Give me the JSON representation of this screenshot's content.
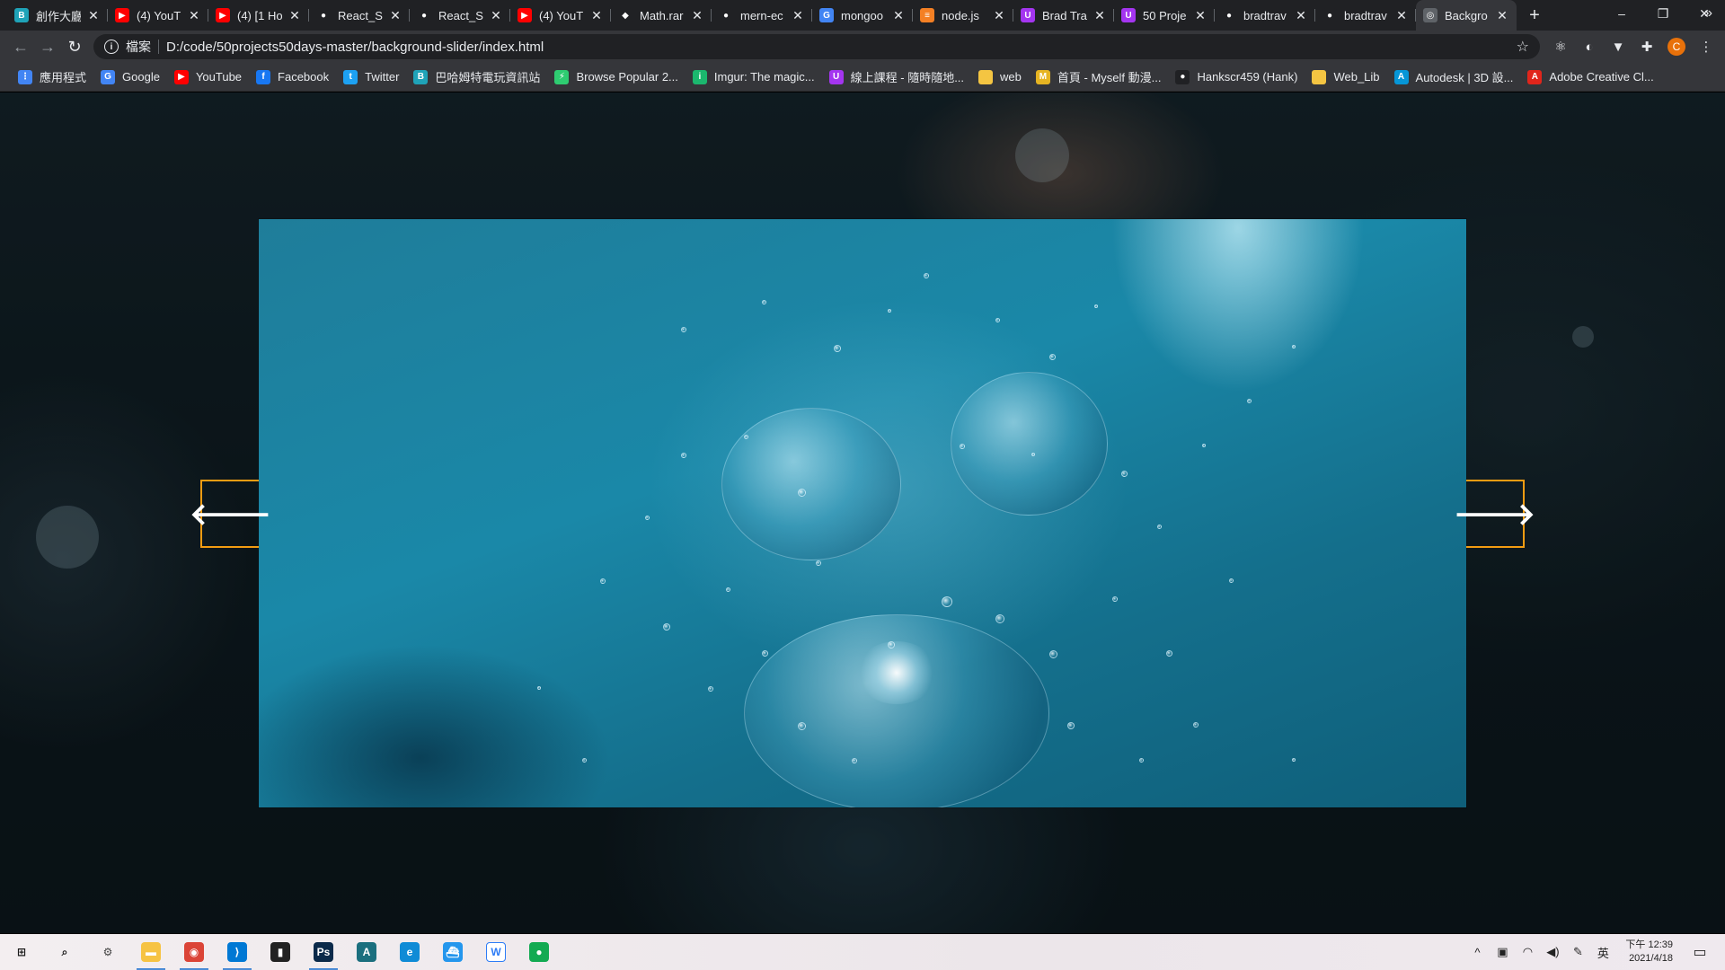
{
  "browser": {
    "tabs": [
      {
        "title": "創作大廳",
        "favicon_color": "#1fa3b8",
        "glyph": "B"
      },
      {
        "title": "(4) YouT",
        "favicon_color": "#ff0000",
        "glyph": "▶"
      },
      {
        "title": "(4) [1 Ho",
        "favicon_color": "#ff0000",
        "glyph": "▶"
      },
      {
        "title": "React_Sl",
        "favicon_color": "#202124",
        "glyph": "●"
      },
      {
        "title": "React_Sl",
        "favicon_color": "#202124",
        "glyph": "●"
      },
      {
        "title": "(4) YouT",
        "favicon_color": "#ff0000",
        "glyph": "▶"
      },
      {
        "title": "Math.rar",
        "favicon_color": "#202124",
        "glyph": "◆"
      },
      {
        "title": "mern-ec",
        "favicon_color": "#202124",
        "glyph": "●"
      },
      {
        "title": "mongoo",
        "favicon_color": "#4285f4",
        "glyph": "G"
      },
      {
        "title": "node.js",
        "favicon_color": "#f48024",
        "glyph": "≡"
      },
      {
        "title": "Brad Tra",
        "favicon_color": "#a435f0",
        "glyph": "U"
      },
      {
        "title": "50 Proje",
        "favicon_color": "#a435f0",
        "glyph": "U"
      },
      {
        "title": "bradtrav",
        "favicon_color": "#202124",
        "glyph": "●"
      },
      {
        "title": "bradtrav",
        "favicon_color": "#202124",
        "glyph": "●"
      },
      {
        "title": "Backgro",
        "favicon_color": "#5f6368",
        "glyph": "◎",
        "active": true
      }
    ],
    "new_tab_label": "+",
    "window_controls": {
      "minimize": "–",
      "restore": "❐",
      "close": "✕"
    },
    "toolbar": {
      "back": "←",
      "forward": "→",
      "reload": "↻",
      "scheme_label": "檔案",
      "url": "D:/code/50projects50days-master/background-slider/index.html",
      "bookmark_star": "☆",
      "profile_initial": "C"
    },
    "bookmarks": [
      {
        "label": "應用程式",
        "color": "#4285f4",
        "glyph": "⋮"
      },
      {
        "label": "Google",
        "color": "#4285f4",
        "glyph": "G"
      },
      {
        "label": "YouTube",
        "color": "#ff0000",
        "glyph": "▶"
      },
      {
        "label": "Facebook",
        "color": "#1877f2",
        "glyph": "f"
      },
      {
        "label": "Twitter",
        "color": "#1da1f2",
        "glyph": "t"
      },
      {
        "label": "巴哈姆特電玩資訊站",
        "color": "#1fa3b8",
        "glyph": "B"
      },
      {
        "label": "Browse Popular 2...",
        "color": "#2ecc71",
        "glyph": "⚡"
      },
      {
        "label": "Imgur: The magic...",
        "color": "#1bb76e",
        "glyph": "i"
      },
      {
        "label": "線上課程 - 隨時隨地...",
        "color": "#a435f0",
        "glyph": "U"
      },
      {
        "label": "web",
        "color": "#f4c542",
        "glyph": ""
      },
      {
        "label": "首頁 - Myself 動漫...",
        "color": "#e6b422",
        "glyph": "M"
      },
      {
        "label": "Hankscr459 (Hank)",
        "color": "#202124",
        "glyph": "●"
      },
      {
        "label": "Web_Lib",
        "color": "#f4c542",
        "glyph": ""
      },
      {
        "label": "Autodesk | 3D 設...",
        "color": "#0696d7",
        "glyph": "A"
      },
      {
        "label": "Adobe Creative Cl...",
        "color": "#e1251b",
        "glyph": "A"
      }
    ],
    "bookmarks_more": "»"
  },
  "slider": {
    "prev_arrow": "🡐",
    "next_arrow": "🡒",
    "accent_color": "#f39c12"
  },
  "taskbar": {
    "apps": [
      {
        "name": "start",
        "glyph": "⊞",
        "color": "#1a1a1a"
      },
      {
        "name": "search",
        "glyph": "⌕",
        "color": "#1a1a1a"
      },
      {
        "name": "settings",
        "glyph": "⚙",
        "color": "#444"
      },
      {
        "name": "file-explorer",
        "glyph": "▬",
        "color": "#f6c343",
        "running": true
      },
      {
        "name": "chrome",
        "glyph": "◉",
        "color": "#db4437",
        "running": true
      },
      {
        "name": "vscode",
        "glyph": "⟩",
        "color": "#0078d4",
        "running": true
      },
      {
        "name": "terminal",
        "glyph": "▮",
        "color": "#222"
      },
      {
        "name": "photoshop",
        "glyph": "Ps",
        "color": "#0b2a4a",
        "running": true
      },
      {
        "name": "autodesk",
        "glyph": "A",
        "color": "#1b6f7e"
      },
      {
        "name": "edge",
        "glyph": "e",
        "color": "#0f8bd6"
      },
      {
        "name": "docker",
        "glyph": "⛴",
        "color": "#2496ed"
      },
      {
        "name": "webstorm",
        "glyph": "W",
        "color": "#ffffff"
      },
      {
        "name": "mongodb-compass",
        "glyph": "●",
        "color": "#13aa52"
      }
    ],
    "tray": {
      "chevron": "^",
      "time": "下午 12:39",
      "date": "2021/4/18",
      "ime": "英",
      "notifications": "▭"
    }
  }
}
